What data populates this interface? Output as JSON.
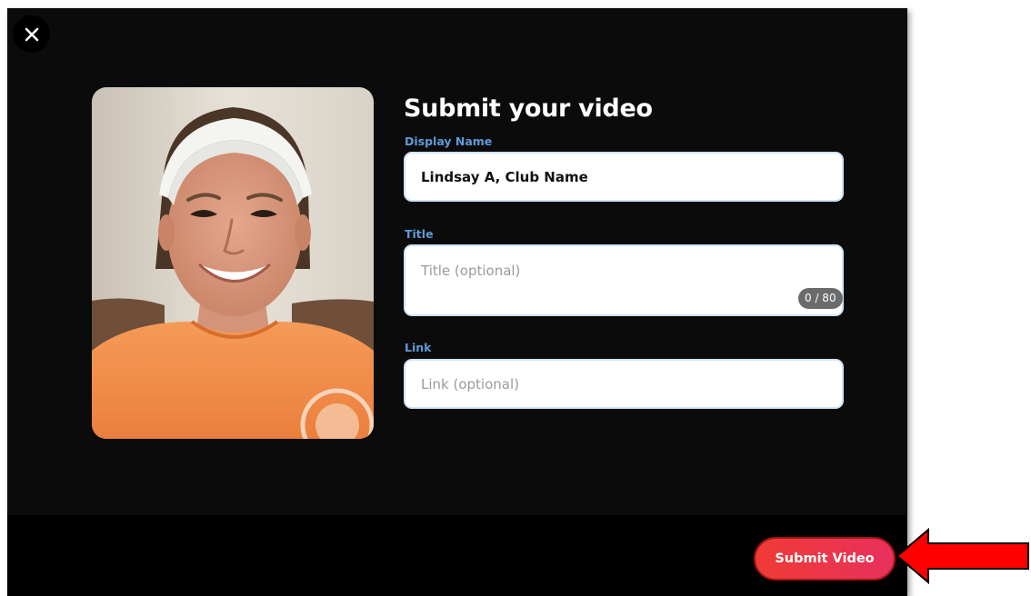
{
  "dialog": {
    "close_icon": "close-icon",
    "photo_icon": "webcam-preview-image"
  },
  "form": {
    "heading": "Submit your video",
    "display_name": {
      "label": "Display Name",
      "value": "Lindsay A, Club Name"
    },
    "title": {
      "label": "Title",
      "placeholder": "Title (optional)",
      "value": "",
      "char_count": "0 / 80"
    },
    "link": {
      "label": "Link",
      "placeholder": "Link (optional)",
      "value": ""
    }
  },
  "footer": {
    "submit_label": "Submit Video"
  },
  "annotation": {
    "icon": "red-arrow-pointer",
    "color": "#ff0000"
  },
  "colors": {
    "label_blue": "#5e9ad8",
    "submit_gradient_start": "#ef3b35",
    "submit_gradient_end": "#e8305d"
  }
}
